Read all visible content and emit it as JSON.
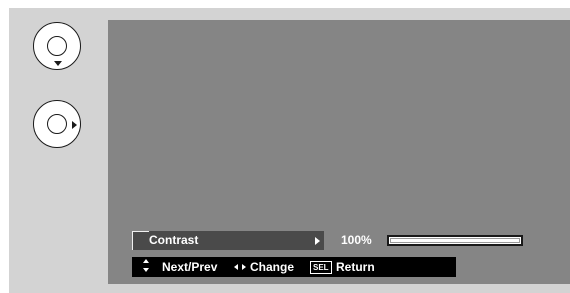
{
  "remote": {
    "buttons": [
      {
        "icon": "ring-down-arrow-icon"
      },
      {
        "icon": "ring-right-arrow-icon"
      }
    ]
  },
  "menu": {
    "item_label": "Contrast",
    "value_text": "100%",
    "level_fraction": 1.0
  },
  "help": {
    "next_prev": "Next/Prev",
    "change": "Change",
    "sel_key": "SEL",
    "return": "Return"
  },
  "colors": {
    "panel_bg": "#d3d3d3",
    "screen_bg": "#858585",
    "menu_row_bg": "#4a4a4a",
    "helpbar_bg": "#000000"
  }
}
